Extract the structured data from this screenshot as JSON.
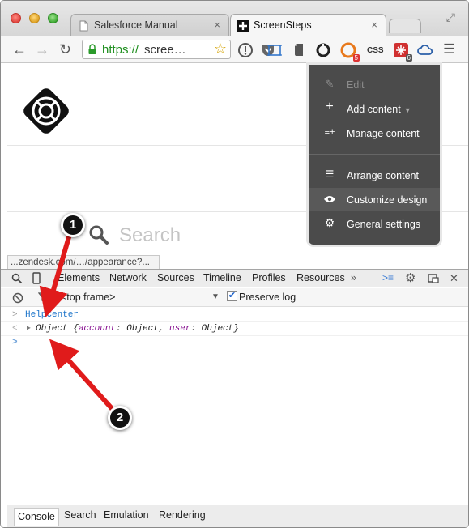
{
  "browser": {
    "tabs": [
      {
        "title": "Salesforce Manual",
        "active": false
      },
      {
        "title": "ScreenSteps",
        "active": true
      }
    ],
    "tab_close": "×",
    "address": {
      "scheme": "https://",
      "rest": "scree…"
    },
    "extension_badges": {
      "lastpass": "5",
      "css": "CSS",
      "other": "6"
    }
  },
  "page": {
    "search_placeholder": "Search"
  },
  "admin_menu": {
    "items": [
      {
        "label": "Edit",
        "icon": "pencil-icon",
        "disabled": true
      },
      {
        "label": "Add content",
        "icon": "plus-icon",
        "has_caret": true
      },
      {
        "label": "Manage content",
        "icon": "list-plus-icon"
      },
      {
        "label": "Arrange content",
        "icon": "list-icon"
      },
      {
        "label": "Customize design",
        "icon": "eye-icon",
        "highlighted": true
      },
      {
        "label": "General settings",
        "icon": "gear-icon"
      }
    ]
  },
  "status_bar": {
    "url": "...zendesk.com/…/appearance?..."
  },
  "devtools": {
    "tabs": [
      "Elements",
      "Network",
      "Sources",
      "Timeline",
      "Profiles",
      "Resources"
    ],
    "more": "»",
    "frame_selector": "<top frame>",
    "preserve_log_label": "Preserve log",
    "preserve_log_checked": true,
    "console": {
      "input": "HelpCenter",
      "output_prefix": "Object",
      "output_body_open": " {",
      "output_key1": "account",
      "output_val1": ": Object, ",
      "output_key2": "user",
      "output_val2": ": Object}"
    },
    "drawer_tabs": [
      "Console",
      "Search",
      "Emulation",
      "Rendering"
    ]
  },
  "annotations": [
    {
      "number": "1"
    },
    {
      "number": "2"
    }
  ],
  "colors": {
    "arrow": "#e01b1b",
    "menu_bg": "#4b4b4b",
    "link_blue": "#1a73c9"
  }
}
